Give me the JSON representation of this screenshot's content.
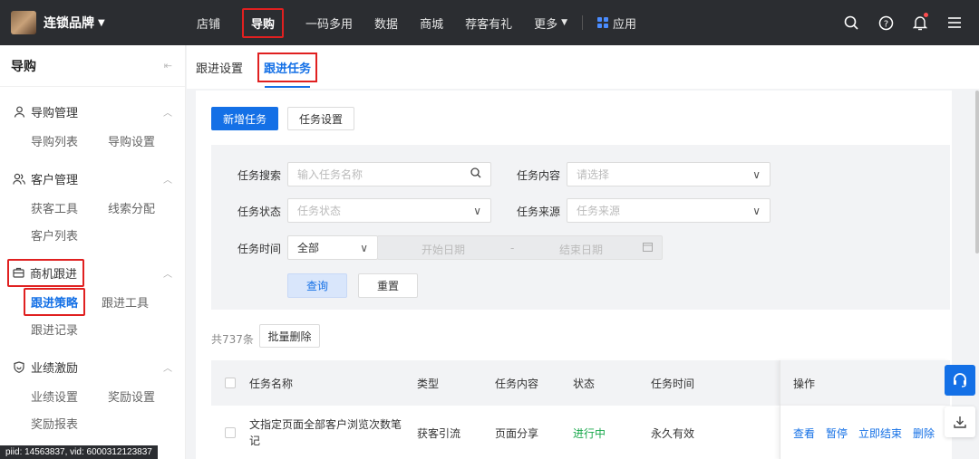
{
  "brand": {
    "name": "连锁品牌"
  },
  "nav": {
    "items": [
      "店铺",
      "导购",
      "一码多用",
      "数据",
      "商城",
      "荐客有礼",
      "更多"
    ],
    "app_label": "应用"
  },
  "sidebar": {
    "title": "导购",
    "groups": [
      {
        "label": "导购管理",
        "items": [
          "导购列表",
          "导购设置"
        ]
      },
      {
        "label": "客户管理",
        "items": [
          "获客工具",
          "线索分配",
          "客户列表"
        ]
      },
      {
        "label": "商机跟进",
        "items": [
          "跟进策略",
          "跟进工具",
          "跟进记录"
        ]
      },
      {
        "label": "业绩激励",
        "items": [
          "业绩设置",
          "奖励设置",
          "奖励报表"
        ]
      }
    ]
  },
  "footer_id": "piid: 14563837, vid: 6000312123837",
  "tabs": [
    "跟进设置",
    "跟进任务"
  ],
  "actions": {
    "add": "新增任务",
    "settings": "任务设置"
  },
  "filters": {
    "search_label": "任务搜索",
    "search_placeholder": "输入任务名称",
    "content_label": "任务内容",
    "content_placeholder": "请选择",
    "status_label": "任务状态",
    "status_placeholder": "任务状态",
    "source_label": "任务来源",
    "source_placeholder": "任务来源",
    "time_label": "任务时间",
    "time_value": "全部",
    "start_date": "开始日期",
    "date_sep": "-",
    "end_date": "结束日期",
    "query": "查询",
    "reset": "重置"
  },
  "list": {
    "count_text": "共737条",
    "batch_delete": "批量删除"
  },
  "table": {
    "headers": [
      "任务名称",
      "类型",
      "任务内容",
      "状态",
      "任务时间",
      "操作"
    ],
    "rows": [
      {
        "name": "文指定页面全部客户浏览次数笔记",
        "type": "获客引流",
        "content": "页面分享",
        "status": "进行中",
        "time": "永久有效",
        "ops": [
          "查看",
          "暂停",
          "立即结束",
          "删除"
        ]
      }
    ]
  },
  "colors": {
    "primary": "#1470e6",
    "highlight": "#e02020",
    "status_active": "#18a84b",
    "topbar": "#2b2d31"
  }
}
